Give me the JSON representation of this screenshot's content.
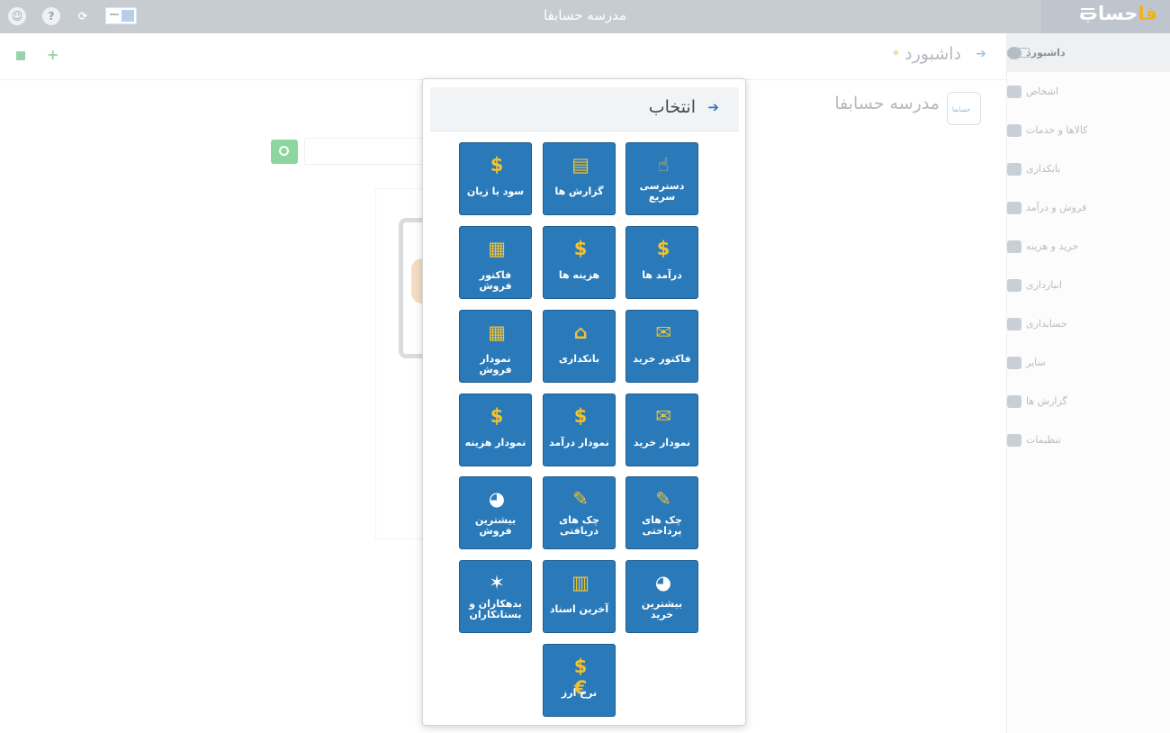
{
  "topbar": {
    "title": "مدرسه حسابفا",
    "logo_text": "حساب",
    "logo_mark": "فا",
    "icons": [
      "user-avatar-icon",
      "help-icon",
      "refresh-icon",
      "language-flag-icon",
      "menu-icon"
    ]
  },
  "sidebar": {
    "items": [
      {
        "label": "داشبورد",
        "icon": "dashboard-icon",
        "active": true
      },
      {
        "label": "اشخاص",
        "icon": "people-icon"
      },
      {
        "label": "کالاها و خدمات",
        "icon": "box-icon"
      },
      {
        "label": "بانکداری",
        "icon": "bank-icon"
      },
      {
        "label": "فروش و درآمد",
        "icon": "sales-icon"
      },
      {
        "label": "خرید و هزینه",
        "icon": "purchase-icon"
      },
      {
        "label": "انبارداری",
        "icon": "warehouse-icon"
      },
      {
        "label": "حسابداری",
        "icon": "accounting-icon"
      },
      {
        "label": "سایر",
        "icon": "other-icon"
      },
      {
        "label": "گزارش ها",
        "icon": "reports-icon"
      },
      {
        "label": "تنظیمات",
        "icon": "settings-icon"
      }
    ]
  },
  "content": {
    "title": "داشبورد",
    "star": "*",
    "business_name": "مدرسه حسابفا",
    "logo_small": "حسابفا"
  },
  "modal": {
    "title": "انتخاب",
    "tiles": [
      {
        "label": "دسترسی سریع",
        "icon": "quick-access-icon"
      },
      {
        "label": "گزارش ها",
        "icon": "report-icon"
      },
      {
        "label": "سود یا زیان",
        "icon": "profit-loss-icon"
      },
      {
        "label": "درآمد ها",
        "icon": "income-icon"
      },
      {
        "label": "هزینه ها",
        "icon": "expense-icon"
      },
      {
        "label": "فاکتور فروش",
        "icon": "sales-invoice-icon"
      },
      {
        "label": "فاکتور خرید",
        "icon": "purchase-invoice-icon"
      },
      {
        "label": "بانکداری",
        "icon": "bank-icon"
      },
      {
        "label": "نمودار فروش",
        "icon": "sales-chart-icon"
      },
      {
        "label": "نمودار خرید",
        "icon": "purchase-chart-icon"
      },
      {
        "label": "نمودار درآمد",
        "icon": "income-chart-icon"
      },
      {
        "label": "نمودار هزینه",
        "icon": "expense-chart-icon"
      },
      {
        "label": "چک های پرداختی",
        "icon": "paid-cheque-icon"
      },
      {
        "label": "چک های دریافتی",
        "icon": "received-cheque-icon"
      },
      {
        "label": "بیشترین فروش",
        "icon": "top-sales-pie-icon"
      },
      {
        "label": "بیشترین خرید",
        "icon": "top-purchase-pie-icon"
      },
      {
        "label": "آخرین اسناد",
        "icon": "latest-documents-icon"
      },
      {
        "label": "بدهکاران و بستانکاران",
        "icon": "debtors-creditors-icon"
      },
      {
        "label": "نرخ ارز",
        "icon": "exchange-rate-icon"
      }
    ]
  },
  "colors": {
    "tile_blue": "#2a7ab9",
    "icon_yellow": "#f1c232",
    "topbar_gray": "#c7ccd3",
    "accent_green": "#8ed6a0"
  }
}
